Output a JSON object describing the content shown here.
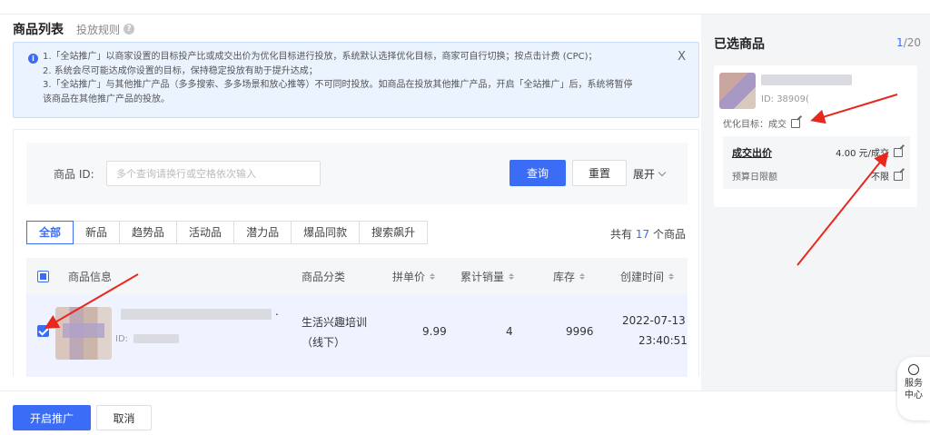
{
  "header": {
    "title": "商品列表",
    "rule_link": "投放规则"
  },
  "notice": {
    "lines": [
      "1.「全站推广」以商家设置的目标投产比或成交出价为优化目标进行投放，系统默认选择优化目标，商家可自行切换；按点击计费 (CPC)；",
      "2. 系统会尽可能达成你设置的目标，保持稳定投放有助于提升达成；",
      "3.「全站推广」与其他推广产品（多多搜索、多多场景和放心推等）不可同时投放。如商品在投放其他推广产品，开启「全站推广」后，系统将暂停",
      "该商品在其他推广产品的投放。"
    ],
    "close": "X"
  },
  "filter": {
    "label": "商品 ID:",
    "placeholder": "多个查询请换行或空格依次输入",
    "query_button": "查询",
    "reset_button": "重置",
    "expand_button": "展开"
  },
  "tabs": [
    "全部",
    "新品",
    "趋势品",
    "活动品",
    "潜力品",
    "爆品同款",
    "搜索飙升"
  ],
  "total": {
    "prefix": "共有",
    "count": "17",
    "suffix": "个商品"
  },
  "table": {
    "columns": {
      "info": "商品信息",
      "category": "商品分类",
      "price": "拼单价",
      "sales": "累计销量",
      "stock": "库存",
      "created": "创建时间"
    },
    "rows": [
      {
        "id_label": "ID:",
        "category_line1": "生活兴趣培训",
        "category_line2": "（线下）",
        "price": "9.99",
        "sales": "4",
        "stock": "9996",
        "date": "2022-07-13",
        "time": "23:40:51"
      }
    ]
  },
  "selected": {
    "title": "已选商品",
    "count_current": "1",
    "count_total": "/20",
    "item": {
      "id": "ID: 38909(",
      "opt_target": "优化目标：成交",
      "bid_label": "成交出价",
      "bid_value": "4.00 元/成交",
      "budget_label": "预算日限额",
      "budget_value": "不限"
    }
  },
  "actions": {
    "start": "开启推广",
    "cancel": "取消"
  },
  "service": {
    "line1": "服务",
    "line2": "中心"
  },
  "colors": {
    "accent": "#3b6cf5",
    "arrow": "#e8281e",
    "notice_bg": "#ebf3ff"
  }
}
